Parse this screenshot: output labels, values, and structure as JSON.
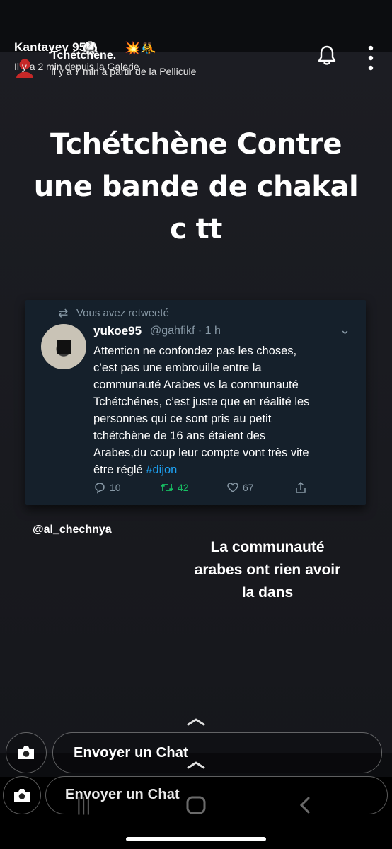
{
  "header": {
    "username": "Kantayev 95",
    "username_meta": "Il y a 2 min depuis la Galerie",
    "story_title": "Tchétchène.",
    "story_meta": "Il y a 7 min à partir de la Pellicule",
    "emojis": [
      "🥋",
      "💥",
      "🤼"
    ],
    "icons": {
      "notification": "bell-icon",
      "more": "more-vertical-icon"
    }
  },
  "caption": {
    "lines": [
      "Tchétchène Contre",
      "une bande de chakal",
      "c tt"
    ]
  },
  "tweet": {
    "retweet_label": "Vous avez retweeté",
    "author_name": "yukoe95",
    "author_handle": "@gahfikf · 1 h",
    "body_lines": [
      "Attention ne confondez pas les choses,",
      "c’est pas une embrouille entre la",
      "communauté Arabes vs la communauté",
      "Tchétchénes, c’est juste que en réalité les",
      "personnes qui ce sont pris au petit",
      "tchétchène de 16 ans étaient des",
      "Arabes,du coup leur compte vont très vite",
      "être réglé"
    ],
    "hashtag": "#dijon",
    "actions": {
      "replies": "10",
      "retweets": "42",
      "likes": "67"
    },
    "colors": {
      "background": "#15202b",
      "muted": "#8899a6",
      "hashtag": "#1da1f2",
      "retweet_active": "#17bf63"
    }
  },
  "mention": "@al_chechnya",
  "caption2": {
    "lines": [
      "La communauté",
      "arabes ont rien avoir",
      "la dans"
    ]
  },
  "chat": {
    "primary_label": "Envoyer un Chat",
    "secondary_label": "Envoyer un Chat"
  }
}
